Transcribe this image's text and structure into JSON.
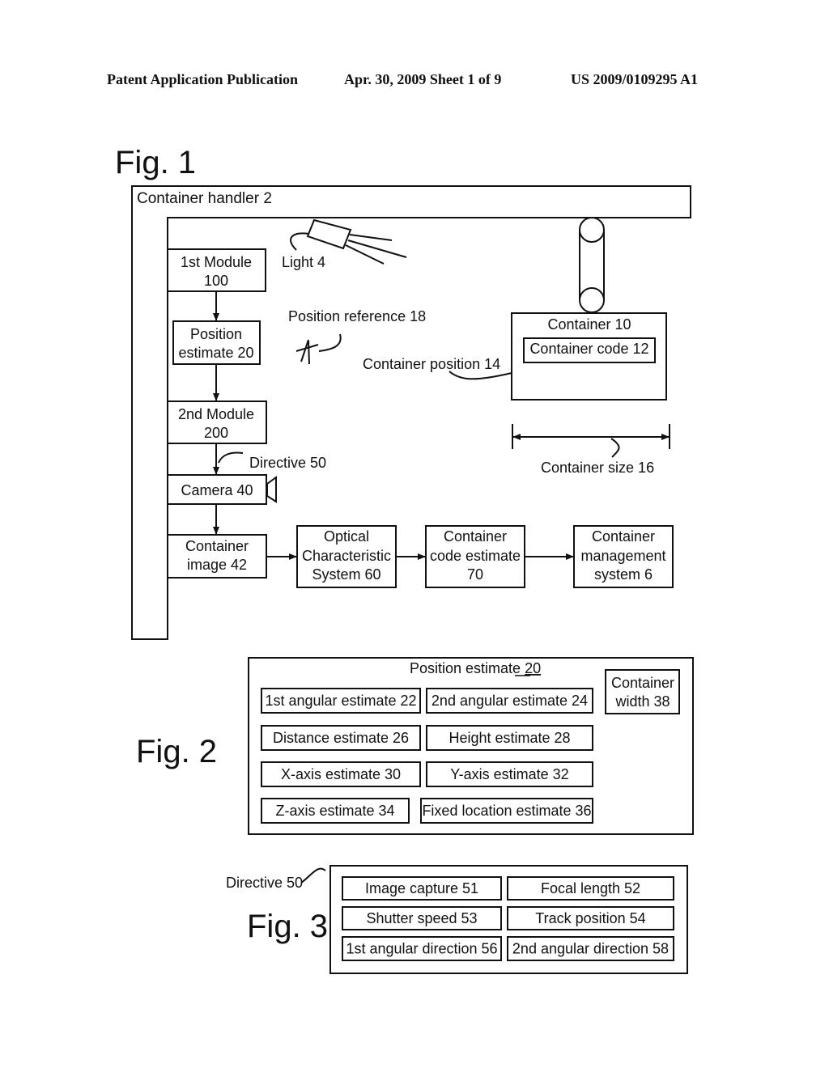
{
  "header": {
    "left": "Patent Application Publication",
    "center": "Apr. 30, 2009  Sheet 1 of 9",
    "right": "US 2009/0109295 A1"
  },
  "fig1": {
    "title": "Fig. 1",
    "container_handler": "Container handler 2",
    "light": "Light 4",
    "first_module": [
      "1st Module",
      "100"
    ],
    "position_estimate": [
      "Position",
      "estimate 20"
    ],
    "second_module": [
      "2nd Module",
      "200"
    ],
    "directive": "Directive 50",
    "camera": "Camera 40",
    "container_image": [
      "Container",
      "image 42"
    ],
    "ocs": [
      "Optical",
      "Characteristic",
      "System 60"
    ],
    "code_estimate": [
      "Container",
      "code estimate",
      "70"
    ],
    "management": [
      "Container",
      "management",
      "system 6"
    ],
    "position_reference": "Position reference 18",
    "container_position": "Container position 14",
    "container": "Container 10",
    "container_code": "Container code 12",
    "container_size": "Container size 16"
  },
  "fig2": {
    "title": "Fig. 2",
    "heading": "Position estimate ",
    "heading_ref": "20",
    "container_width": [
      "Container",
      "width 38"
    ],
    "items": [
      "1st angular estimate 22",
      "2nd angular estimate 24",
      "Distance estimate 26",
      "Height estimate 28",
      "X-axis estimate 30",
      "Y-axis estimate 32",
      "Z-axis estimate 34",
      "Fixed location estimate 36"
    ]
  },
  "fig3": {
    "title": "Fig. 3",
    "directive": "Directive 50",
    "items": [
      "Image capture 51",
      "Focal length 52",
      "Shutter speed 53",
      "Track position 54",
      "1st angular direction 56",
      "2nd angular direction 58"
    ]
  }
}
